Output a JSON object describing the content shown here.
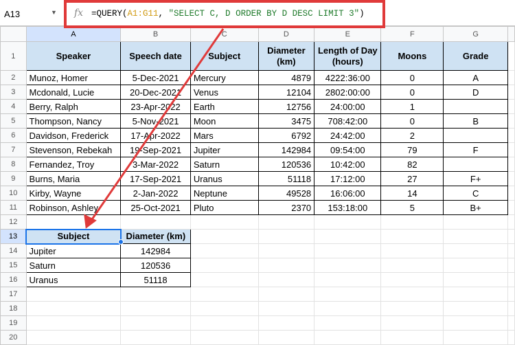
{
  "name_box": "A13",
  "formula": {
    "prefix": "=QUERY(",
    "range": "A1:G11",
    ", ": ", ",
    "query": "\"SELECT C, D ORDER BY D DESC LIMIT 3\"",
    "suffix": ")"
  },
  "columns": [
    "A",
    "B",
    "C",
    "D",
    "E",
    "F",
    "G"
  ],
  "row_numbers": [
    "1",
    "2",
    "3",
    "4",
    "5",
    "6",
    "7",
    "8",
    "9",
    "10",
    "11",
    "12",
    "13",
    "14",
    "15",
    "16",
    "17",
    "18",
    "19",
    "20"
  ],
  "headers": [
    "Speaker",
    "Speech date",
    "Subject",
    "Diameter (km)",
    "Length of Day (hours)",
    "Moons",
    "Grade"
  ],
  "rows": [
    [
      "Munoz, Homer",
      "5-Dec-2021",
      "Mercury",
      "4879",
      "4222:36:00",
      "0",
      "A"
    ],
    [
      "Mcdonald, Lucie",
      "20-Dec-2021",
      "Venus",
      "12104",
      "2802:00:00",
      "0",
      "D"
    ],
    [
      "Berry, Ralph",
      "23-Apr-2022",
      "Earth",
      "12756",
      "24:00:00",
      "1",
      ""
    ],
    [
      "Thompson, Nancy",
      "5-Nov-2021",
      "Moon",
      "3475",
      "708:42:00",
      "0",
      "B"
    ],
    [
      "Davidson, Frederick",
      "17-Apr-2022",
      "Mars",
      "6792",
      "24:42:00",
      "2",
      ""
    ],
    [
      "Stevenson, Rebekah",
      "19-Sep-2021",
      "Jupiter",
      "142984",
      "09:54:00",
      "79",
      "F"
    ],
    [
      "Fernandez, Troy",
      "3-Mar-2022",
      "Saturn",
      "120536",
      "10:42:00",
      "82",
      ""
    ],
    [
      "Burns, Maria",
      "17-Sep-2021",
      "Uranus",
      "51118",
      "17:12:00",
      "27",
      "F+"
    ],
    [
      "Kirby, Wayne",
      "2-Jan-2022",
      "Neptune",
      "49528",
      "16:06:00",
      "14",
      "C"
    ],
    [
      "Robinson, Ashley",
      "25-Oct-2021",
      "Pluto",
      "2370",
      "153:18:00",
      "5",
      "B+"
    ]
  ],
  "result": {
    "headers": [
      "Subject",
      "Diameter (km)"
    ],
    "rows": [
      [
        "Jupiter",
        "142984"
      ],
      [
        "Saturn",
        "120536"
      ],
      [
        "Uranus",
        "51118"
      ]
    ]
  },
  "colors": {
    "header_fill": "#cfe2f3",
    "selection": "#1a73e8",
    "annotation": "#e03a3a"
  }
}
